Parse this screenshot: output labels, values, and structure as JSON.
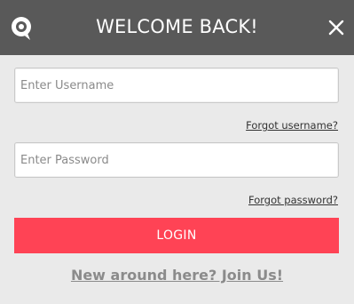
{
  "header": {
    "title": "WELCOME BACK!",
    "logo_icon": "chat-bubble-logo-icon",
    "close_icon": "close-icon"
  },
  "form": {
    "username_placeholder": "Enter Username",
    "password_placeholder": "Enter Password",
    "forgot_username": "Forgot username?",
    "forgot_password": "Forgot password?",
    "login_label": "LOGIN",
    "join_label": "New around here? Join Us!"
  },
  "colors": {
    "header_bg": "#595959",
    "body_bg": "#eaeaea",
    "login_bg": "#ff4355",
    "join_text": "#8b8b8b"
  }
}
